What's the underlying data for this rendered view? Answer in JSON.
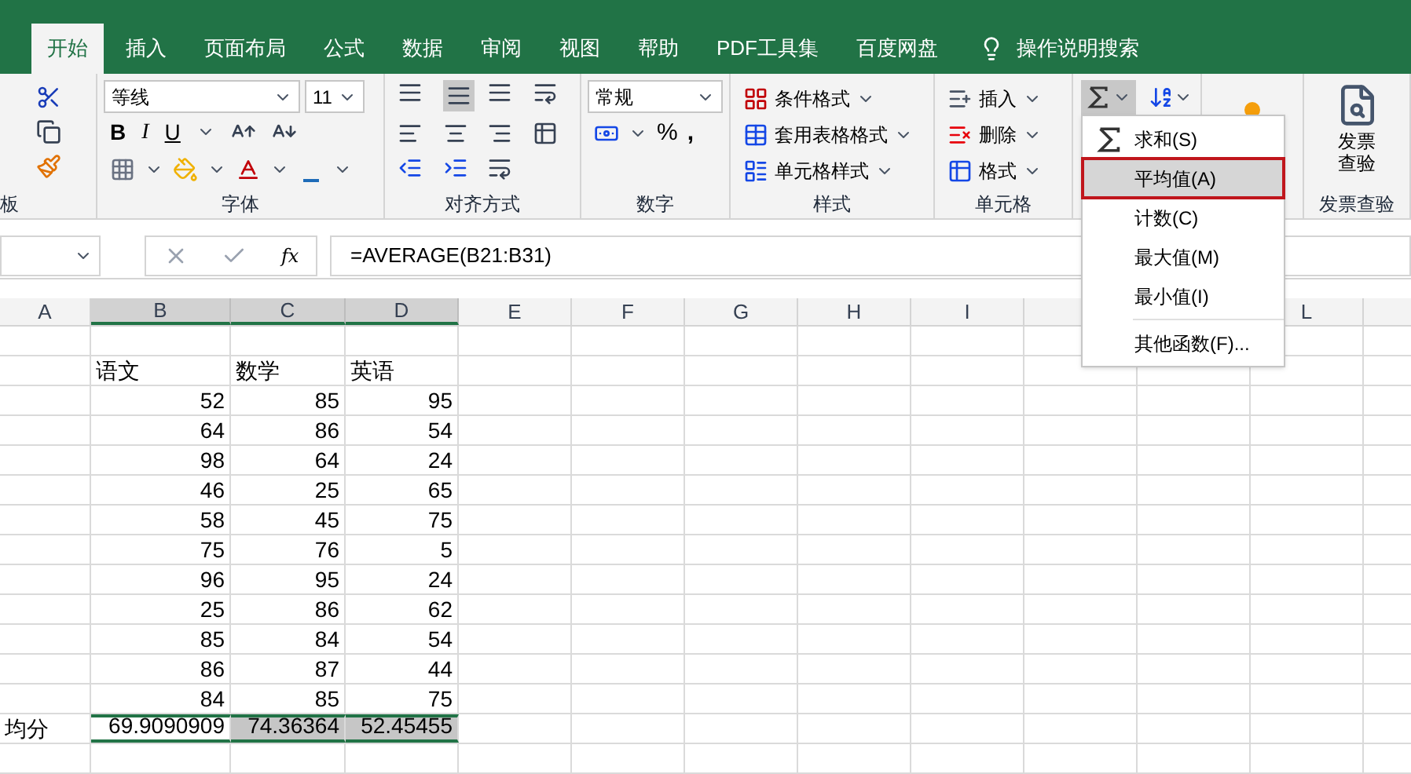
{
  "tabs": [
    {
      "label": "开始",
      "selected": true
    },
    {
      "label": "插入",
      "selected": false
    },
    {
      "label": "页面布局",
      "selected": false
    },
    {
      "label": "公式",
      "selected": false
    },
    {
      "label": "数据",
      "selected": false
    },
    {
      "label": "审阅",
      "selected": false
    },
    {
      "label": "视图",
      "selected": false
    },
    {
      "label": "帮助",
      "selected": false
    },
    {
      "label": "PDF工具集",
      "selected": false
    },
    {
      "label": "百度网盘",
      "selected": false
    }
  ],
  "search_hint": "操作说明搜索",
  "ribbon": {
    "clipboard_label": "板",
    "font": {
      "name": "等线",
      "size": "11",
      "bold": "B",
      "italic": "I",
      "underline": "U",
      "label": "字体"
    },
    "alignment": {
      "label": "对齐方式"
    },
    "number": {
      "format": "常规",
      "percent": "%",
      "comma": ",",
      "label": "数字"
    },
    "styles": {
      "items": [
        "条件格式",
        "套用表格格式",
        "单元格样式"
      ],
      "label": "样式"
    },
    "cells": {
      "items": [
        "插入",
        "删除",
        "格式"
      ],
      "label": "单元格"
    },
    "invoice": {
      "button": "发票查验",
      "label": "发票查验"
    }
  },
  "formula_bar": {
    "fx": "fx",
    "formula": "=AVERAGE(B21:B31)"
  },
  "sheet": {
    "columns": [
      {
        "label": "A",
        "selected": false
      },
      {
        "label": "B",
        "selected": true
      },
      {
        "label": "C",
        "selected": true
      },
      {
        "label": "D",
        "selected": true
      },
      {
        "label": "E",
        "selected": false
      },
      {
        "label": "F",
        "selected": false
      },
      {
        "label": "G",
        "selected": false
      },
      {
        "label": "H",
        "selected": false
      },
      {
        "label": "I",
        "selected": false
      }
    ],
    "columns_after_menu": [
      {
        "label": "L",
        "selected": false
      }
    ],
    "rows": [
      {
        "kind": "blank"
      },
      {
        "kind": "header",
        "cells": [
          "",
          "语文",
          "数学",
          "英语"
        ]
      },
      {
        "kind": "data",
        "cells": [
          "",
          "52",
          "85",
          "95"
        ]
      },
      {
        "kind": "data",
        "cells": [
          "",
          "64",
          "86",
          "54"
        ]
      },
      {
        "kind": "data",
        "cells": [
          "",
          "98",
          "64",
          "24"
        ]
      },
      {
        "kind": "data",
        "cells": [
          "",
          "46",
          "25",
          "65"
        ]
      },
      {
        "kind": "data",
        "cells": [
          "",
          "58",
          "45",
          "75"
        ]
      },
      {
        "kind": "data",
        "cells": [
          "",
          "75",
          "76",
          "5"
        ]
      },
      {
        "kind": "data",
        "cells": [
          "",
          "96",
          "95",
          "24"
        ]
      },
      {
        "kind": "data",
        "cells": [
          "",
          "25",
          "86",
          "62"
        ]
      },
      {
        "kind": "data",
        "cells": [
          "",
          "85",
          "84",
          "54"
        ]
      },
      {
        "kind": "data",
        "cells": [
          "",
          "86",
          "87",
          "44"
        ]
      },
      {
        "kind": "data",
        "cells": [
          "",
          "84",
          "85",
          "75"
        ]
      },
      {
        "kind": "result",
        "label": "均分",
        "cells": [
          {
            "text": "69.9090909",
            "selected": true
          },
          {
            "text": "74.36364",
            "selected": true
          },
          {
            "text": "52.45455",
            "selected": true
          }
        ]
      },
      {
        "kind": "blank"
      }
    ]
  },
  "autosum_menu": {
    "items": [
      {
        "kind": "sum",
        "label": "求和(S)",
        "selected": false
      },
      {
        "kind": "plain",
        "label": "平均值(A)",
        "selected": true
      },
      {
        "kind": "plain",
        "label": "计数(C)",
        "selected": false
      },
      {
        "kind": "plain",
        "label": "最大值(M)",
        "selected": false
      },
      {
        "kind": "plain",
        "label": "最小值(I)",
        "selected": false
      },
      {
        "kind": "more",
        "label": "其他函数(F)...",
        "selected": false
      }
    ]
  }
}
